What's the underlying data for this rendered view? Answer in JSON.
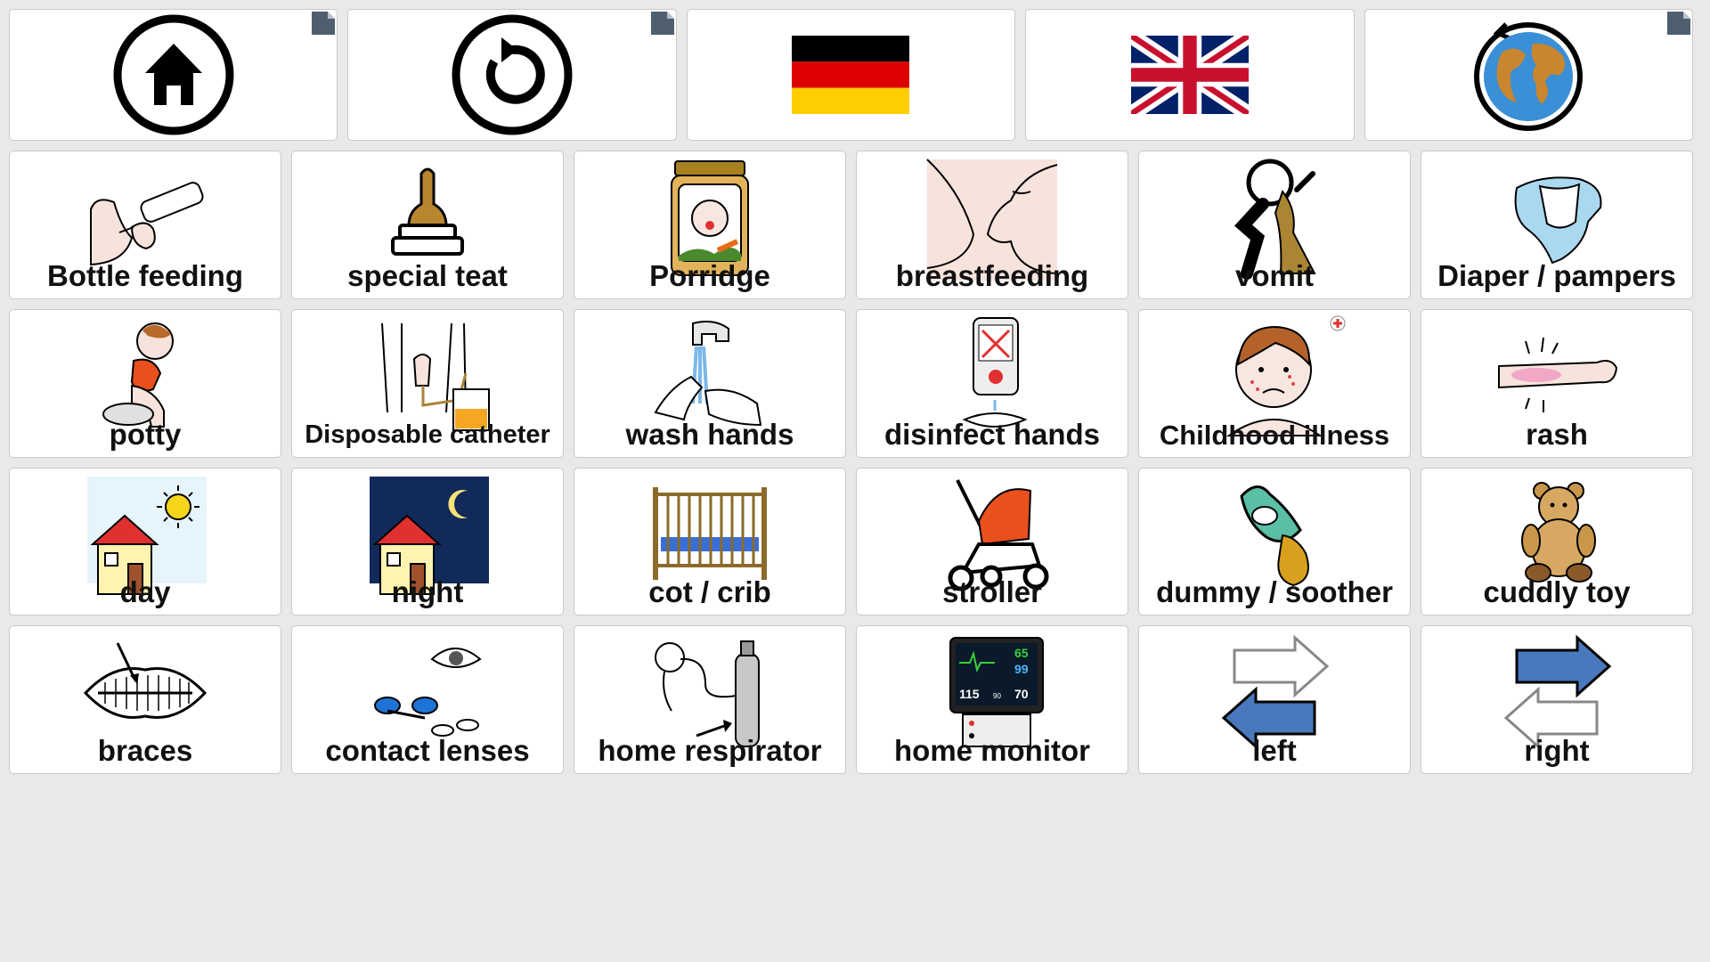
{
  "top_bar": {
    "buttons": [
      "home-icon",
      "back-icon",
      "german-flag-icon",
      "uk-flag-icon",
      "globe-refresh-icon"
    ]
  },
  "grid": {
    "tiles": [
      {
        "label": "Bottle feeding",
        "icon": "bottle-feeding-icon"
      },
      {
        "label": "special teat",
        "icon": "teat-icon"
      },
      {
        "label": "Porridge",
        "icon": "porridge-jar-icon"
      },
      {
        "label": "breastfeeding",
        "icon": "breastfeeding-icon"
      },
      {
        "label": "vomit",
        "icon": "vomit-icon"
      },
      {
        "label": "Diaper / pampers",
        "icon": "diaper-icon"
      },
      {
        "label": "potty",
        "icon": "potty-icon"
      },
      {
        "label": "Disposable catheter",
        "icon": "catheter-icon"
      },
      {
        "label": "wash hands",
        "icon": "wash-hands-icon"
      },
      {
        "label": "disinfect hands",
        "icon": "disinfect-hands-icon"
      },
      {
        "label": "Childhood illness",
        "icon": "sick-child-icon"
      },
      {
        "label": "rash",
        "icon": "rash-icon"
      },
      {
        "label": "day",
        "icon": "day-house-icon"
      },
      {
        "label": "night",
        "icon": "night-house-icon"
      },
      {
        "label": "cot / crib",
        "icon": "crib-icon"
      },
      {
        "label": "stroller",
        "icon": "stroller-icon"
      },
      {
        "label": "dummy / soother",
        "icon": "pacifier-icon"
      },
      {
        "label": "cuddly toy",
        "icon": "teddy-bear-icon"
      },
      {
        "label": "braces",
        "icon": "braces-icon"
      },
      {
        "label": "contact lenses",
        "icon": "contact-lenses-icon"
      },
      {
        "label": "home respirator",
        "icon": "respirator-icon"
      },
      {
        "label": "home monitor",
        "icon": "monitor-icon"
      },
      {
        "label": "left",
        "icon": "left-arrow-icon"
      },
      {
        "label": "right",
        "icon": "right-arrow-icon"
      }
    ]
  },
  "monitor_readout": {
    "top_right": "65",
    "mid_right": "99",
    "bottom_left": "115",
    "bottom_mid": "90",
    "bottom_right": "70"
  },
  "colors": {
    "background": "#e9e9e9",
    "tile": "#ffffff",
    "border": "#c9c9c9",
    "arrow_blue": "#4a78bd"
  }
}
